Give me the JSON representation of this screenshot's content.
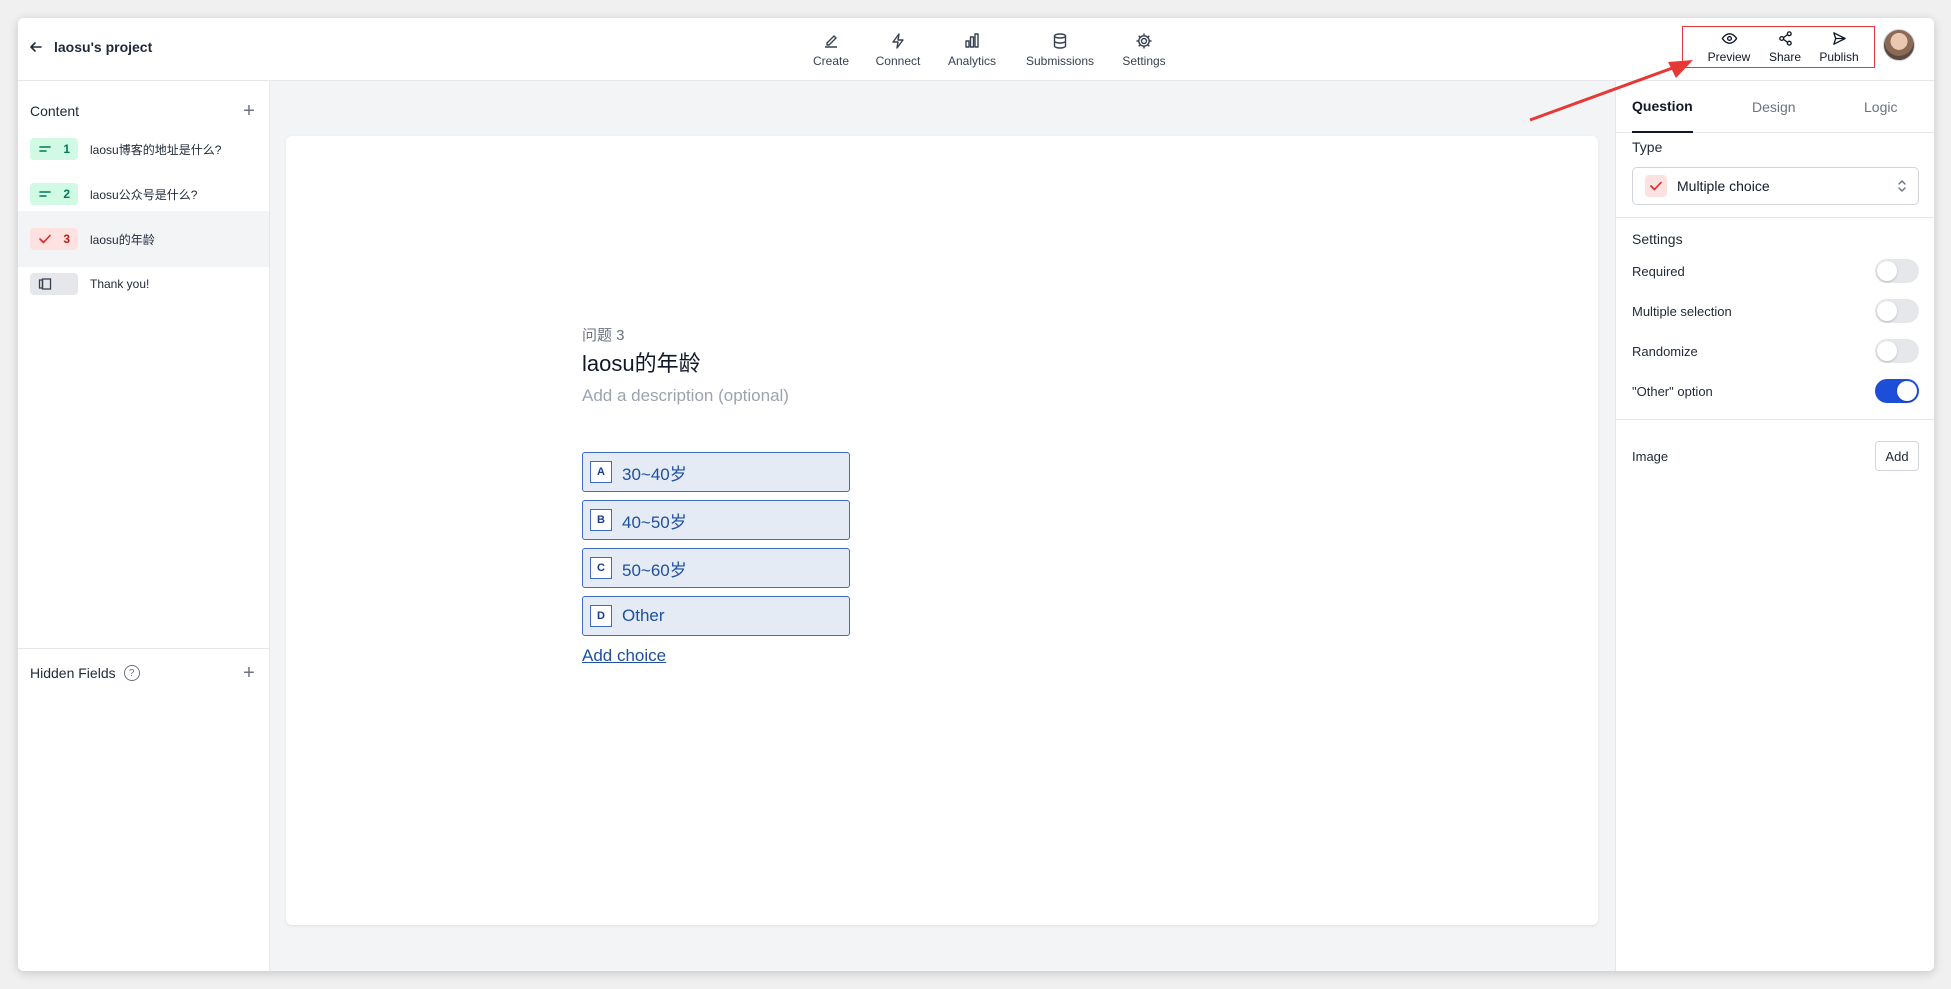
{
  "header": {
    "back_label": "laosu's project",
    "nav": [
      {
        "label": "Create",
        "icon": "pencil-square-icon"
      },
      {
        "label": "Connect",
        "icon": "bolt-icon"
      },
      {
        "label": "Analytics",
        "icon": "bar-chart-icon"
      },
      {
        "label": "Submissions",
        "icon": "database-icon"
      },
      {
        "label": "Settings",
        "icon": "gear-icon"
      }
    ],
    "actions": [
      {
        "label": "Preview",
        "icon": "eye-icon"
      },
      {
        "label": "Share",
        "icon": "share-icon"
      },
      {
        "label": "Publish",
        "icon": "send-icon"
      }
    ],
    "highlight_color": "#e53935"
  },
  "sidebar": {
    "content_title": "Content",
    "items": [
      {
        "number": "1",
        "label": "laosu博客的地址是什么?",
        "type": "short-text"
      },
      {
        "number": "2",
        "label": "laosu公众号是什么?",
        "type": "short-text"
      },
      {
        "number": "3",
        "label": "laosu的年龄",
        "type": "multiple-choice",
        "active": true
      },
      {
        "number": "",
        "label": "Thank you!",
        "type": "ending"
      }
    ],
    "hidden_fields_label": "Hidden Fields",
    "help_glyph": "?"
  },
  "question": {
    "number_label": "问题 3",
    "title": "laosu的年龄",
    "description_placeholder": "Add a description (optional)",
    "choices": [
      {
        "key": "A",
        "label": "30~40岁"
      },
      {
        "key": "B",
        "label": "40~50岁"
      },
      {
        "key": "C",
        "label": "50~60岁"
      },
      {
        "key": "D",
        "label": "Other"
      }
    ],
    "add_choice_label": "Add choice"
  },
  "panel": {
    "tabs": [
      "Question",
      "Design",
      "Logic"
    ],
    "active_tab": "Question",
    "type_title": "Type",
    "type_value": "Multiple choice",
    "settings_title": "Settings",
    "settings": [
      {
        "label": "Required",
        "on": false
      },
      {
        "label": "Multiple selection",
        "on": false
      },
      {
        "label": "Randomize",
        "on": false
      },
      {
        "label": "\"Other\" option",
        "on": true
      }
    ],
    "image_title": "Image",
    "image_add_label": "Add"
  }
}
